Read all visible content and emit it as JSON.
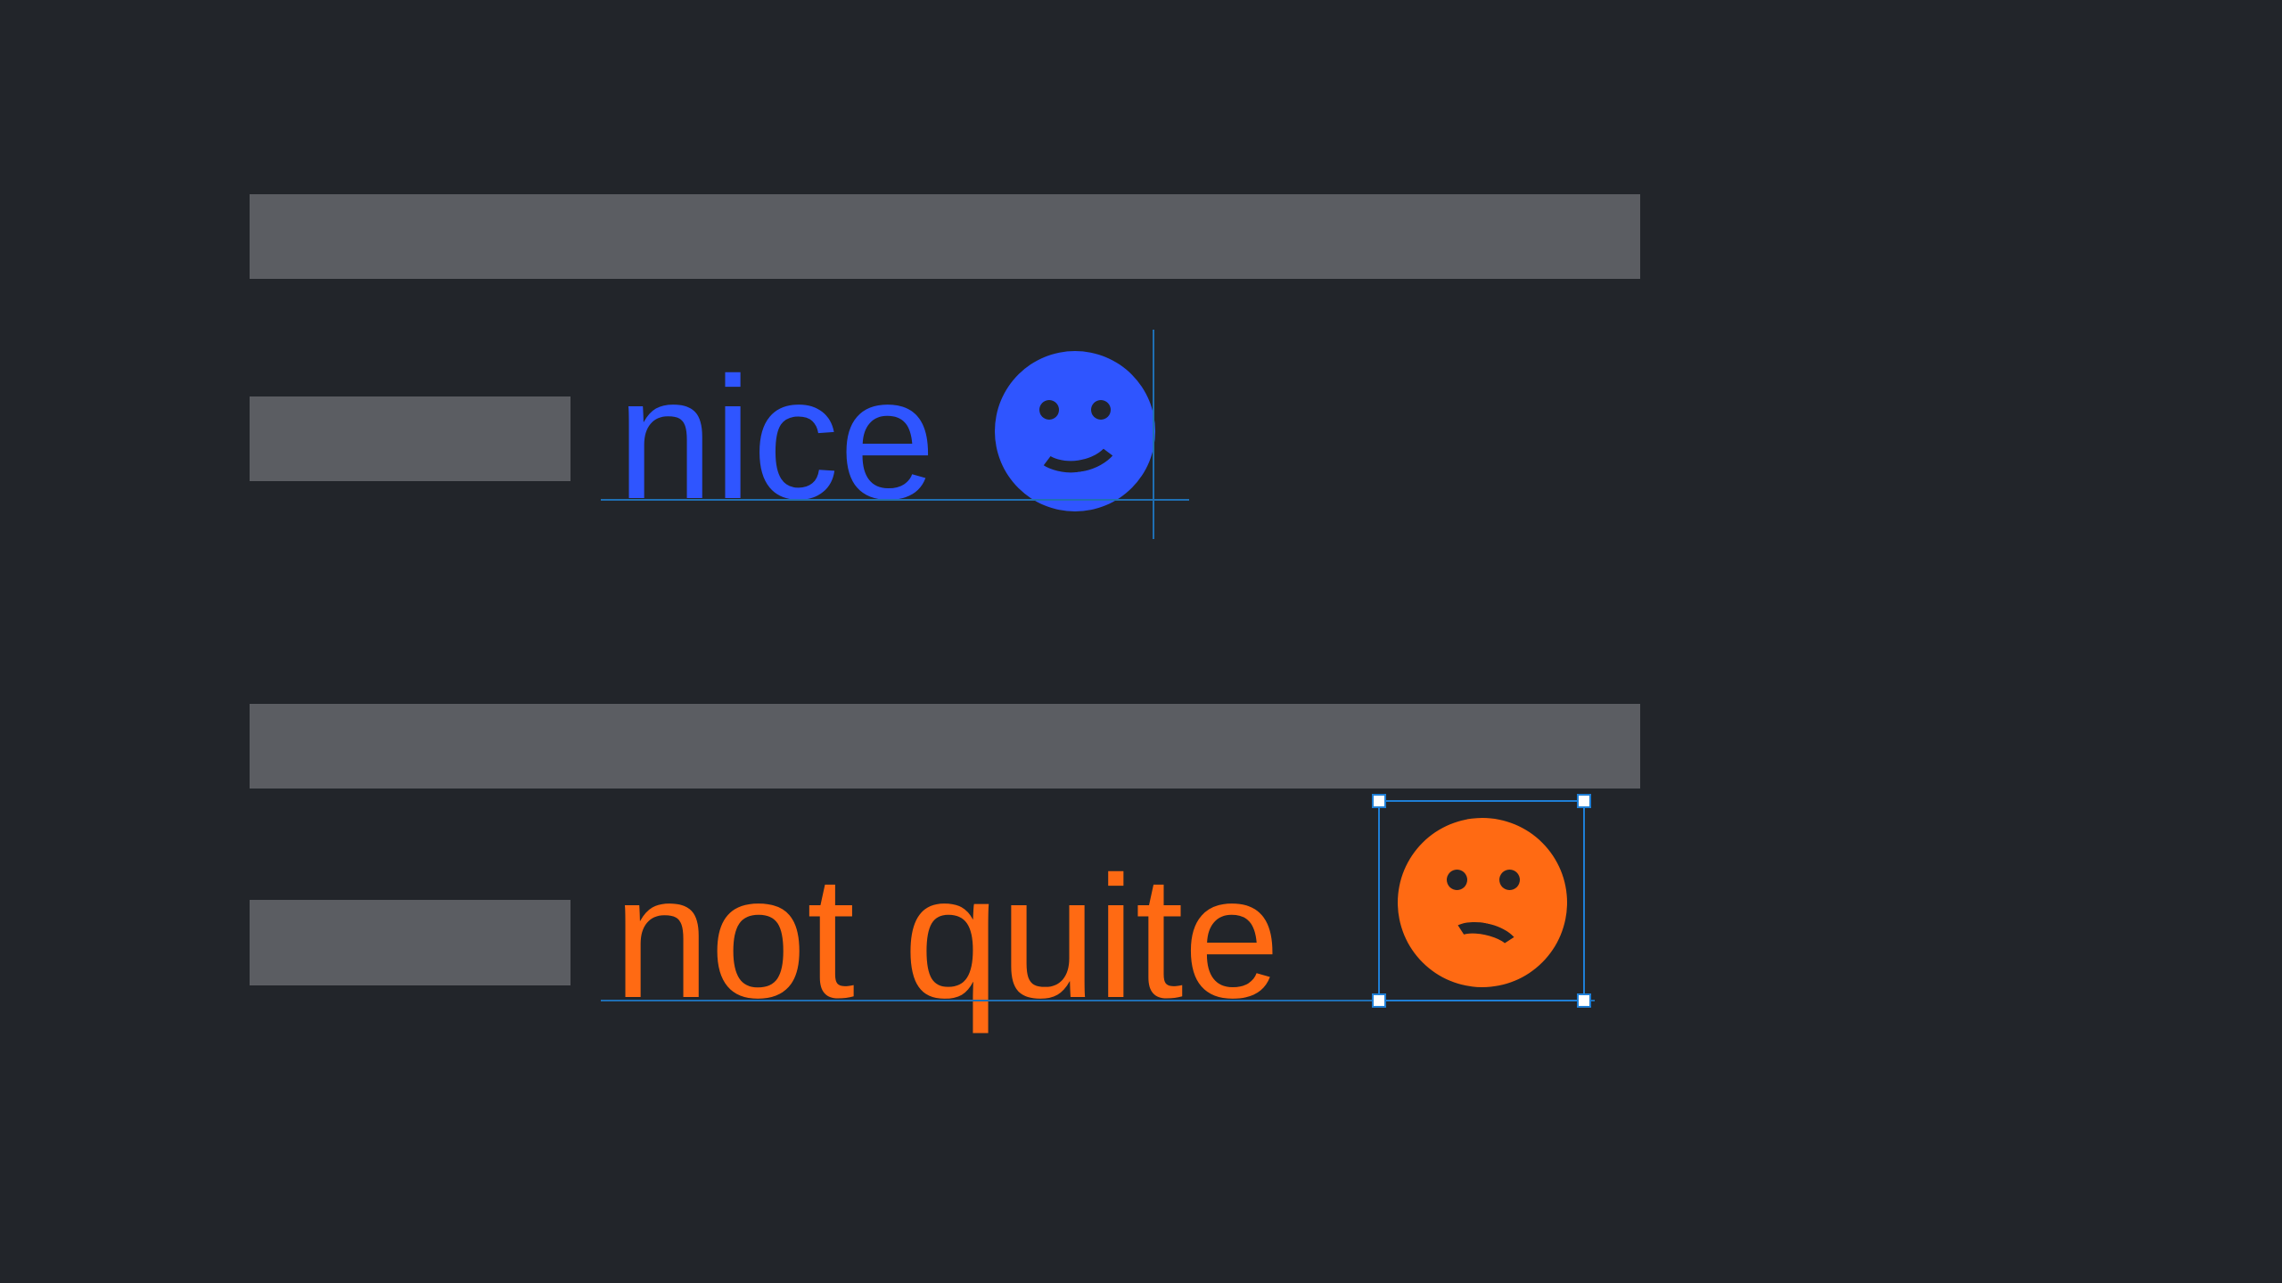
{
  "colors": {
    "background": "#22252a",
    "placeholder_bar": "#5b5d62",
    "blue_text": "#2f55ff",
    "orange_text": "#ff6a13",
    "guide_line": "#1f7fd6",
    "selection_handle": "#ffffff"
  },
  "examples": {
    "good": {
      "label": "nice",
      "emoji": "smiling-face",
      "emoji_color": "#2f55ff",
      "state": "inline-with-text-cursor"
    },
    "bad": {
      "label": "not quite",
      "emoji": "confused-face",
      "emoji_color": "#ff6a13",
      "state": "selected-as-object"
    }
  }
}
